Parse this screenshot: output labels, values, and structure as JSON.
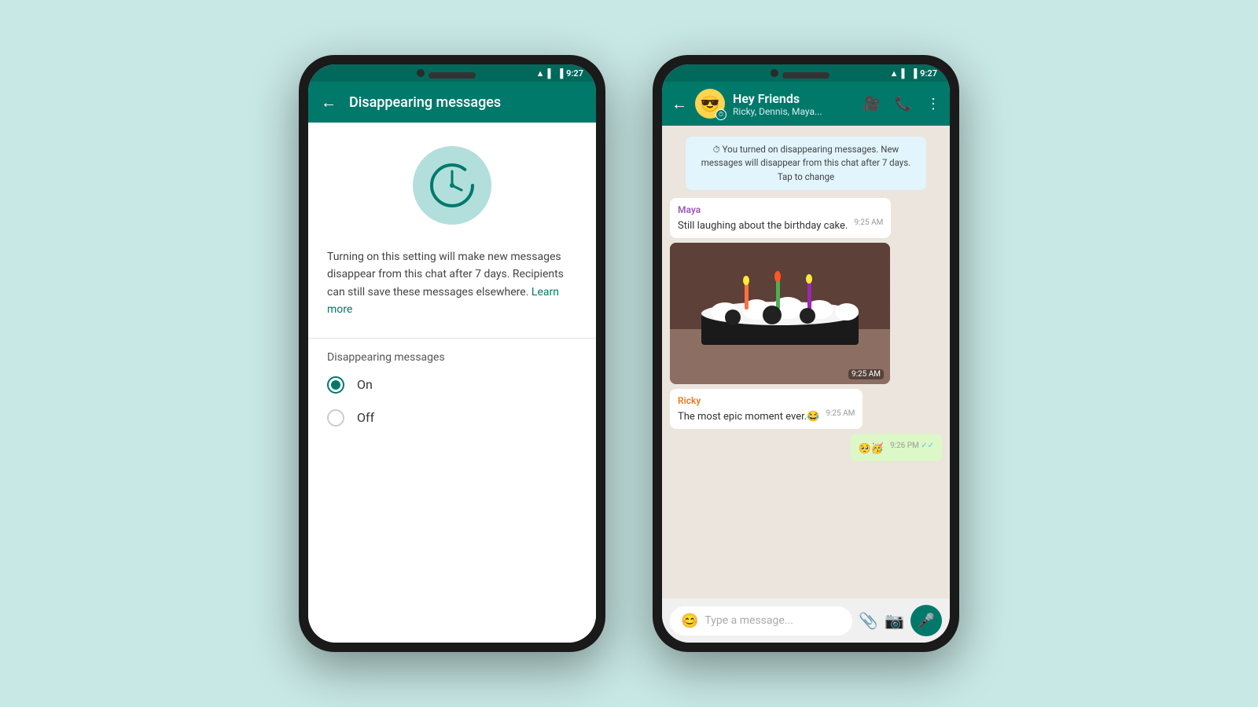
{
  "background_color": "#c8e8e5",
  "phone1": {
    "status_bar": {
      "time": "9:27",
      "icons": [
        "wifi",
        "signal",
        "battery"
      ]
    },
    "header": {
      "back_label": "←",
      "title": "Disappearing messages"
    },
    "description": "Turning on this setting will make new messages disappear from this chat after 7 days. Recipients can still save these messages elsewhere.",
    "learn_more_label": "Learn more",
    "section_label": "Disappearing messages",
    "options": [
      {
        "label": "On",
        "selected": true
      },
      {
        "label": "Off",
        "selected": false
      }
    ]
  },
  "phone2": {
    "status_bar": {
      "time": "9:27",
      "icons": [
        "wifi",
        "signal",
        "battery"
      ]
    },
    "header": {
      "group_name": "Hey Friends",
      "members": "Ricky, Dennis, Maya...",
      "avatar_emoji": "😎",
      "icons": [
        "video",
        "phone",
        "more"
      ]
    },
    "system_message": "You turned on disappearing messages. New messages will disappear from this chat after 7 days. Tap to change",
    "messages": [
      {
        "type": "received",
        "sender": "Maya",
        "sender_color": "maya",
        "text": "Still laughing about the birthday cake.",
        "time": "9:25 AM",
        "has_image": true,
        "image_time": "9:25 AM"
      },
      {
        "type": "received",
        "sender": "Ricky",
        "sender_color": "ricky",
        "text": "The most epic moment ever.😂",
        "time": "9:25 AM"
      },
      {
        "type": "sent",
        "text": "🥺🥳",
        "time": "9:26 PM",
        "checkmarks": true
      }
    ],
    "input_placeholder": "Type a message..."
  }
}
